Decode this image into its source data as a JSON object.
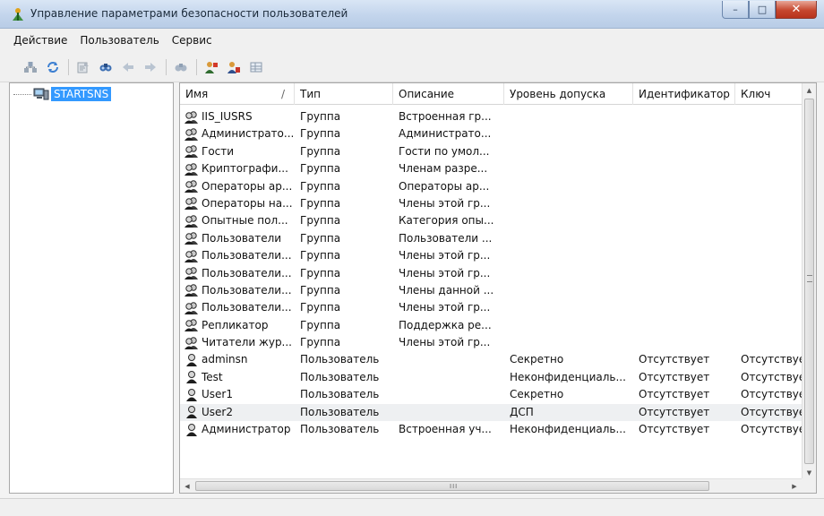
{
  "window": {
    "title": "Управление параметрами безопасности пользователей",
    "buttons": {
      "minimize": "–",
      "maximize": "□",
      "close": "✕"
    }
  },
  "menu": [
    {
      "label": "Действие"
    },
    {
      "label": "Пользователь"
    },
    {
      "label": "Сервис"
    }
  ],
  "toolbar": {
    "icons": [
      "network-connect-icon",
      "refresh-icon",
      "properties-icon",
      "find-icon",
      "back-arrow-icon",
      "forward-arrow-icon",
      "find-next-icon",
      "add-user-icon",
      "user-settings-icon",
      "grid-view-icon"
    ]
  },
  "tree": {
    "root_label": "STARTSNS"
  },
  "columns": [
    {
      "label": "Имя"
    },
    {
      "label": "Тип"
    },
    {
      "label": "Описание"
    },
    {
      "label": "Уровень допуска"
    },
    {
      "label": "Идентификатор"
    },
    {
      "label": "Ключ"
    }
  ],
  "sort_glyph": "/",
  "rows": [
    {
      "icon": "group",
      "name": "IIS_IUSRS",
      "type": "Группа",
      "description": "Встроенная гр...",
      "level": "",
      "id": "",
      "key": ""
    },
    {
      "icon": "group",
      "name": "Администрато...",
      "type": "Группа",
      "description": "Администрато...",
      "level": "",
      "id": "",
      "key": ""
    },
    {
      "icon": "group",
      "name": "Гости",
      "type": "Группа",
      "description": "Гости по умол...",
      "level": "",
      "id": "",
      "key": ""
    },
    {
      "icon": "group",
      "name": "Криптографи...",
      "type": "Группа",
      "description": "Членам разре...",
      "level": "",
      "id": "",
      "key": ""
    },
    {
      "icon": "group",
      "name": "Операторы ар...",
      "type": "Группа",
      "description": "Операторы ар...",
      "level": "",
      "id": "",
      "key": ""
    },
    {
      "icon": "group",
      "name": "Операторы на...",
      "type": "Группа",
      "description": "Члены этой гр...",
      "level": "",
      "id": "",
      "key": ""
    },
    {
      "icon": "group",
      "name": "Опытные пол...",
      "type": "Группа",
      "description": "Категория опы...",
      "level": "",
      "id": "",
      "key": ""
    },
    {
      "icon": "group",
      "name": "Пользователи",
      "type": "Группа",
      "description": "Пользователи ...",
      "level": "",
      "id": "",
      "key": ""
    },
    {
      "icon": "group",
      "name": "Пользователи...",
      "type": "Группа",
      "description": "Члены этой гр...",
      "level": "",
      "id": "",
      "key": ""
    },
    {
      "icon": "group",
      "name": "Пользователи...",
      "type": "Группа",
      "description": "Члены этой гр...",
      "level": "",
      "id": "",
      "key": ""
    },
    {
      "icon": "group",
      "name": "Пользователи...",
      "type": "Группа",
      "description": "Члены данной ...",
      "level": "",
      "id": "",
      "key": ""
    },
    {
      "icon": "group",
      "name": "Пользователи...",
      "type": "Группа",
      "description": "Члены этой гр...",
      "level": "",
      "id": "",
      "key": ""
    },
    {
      "icon": "group",
      "name": "Репликатор",
      "type": "Группа",
      "description": "Поддержка ре...",
      "level": "",
      "id": "",
      "key": ""
    },
    {
      "icon": "group",
      "name": "Читатели жур...",
      "type": "Группа",
      "description": "Члены этой гр...",
      "level": "",
      "id": "",
      "key": ""
    },
    {
      "icon": "user",
      "name": "adminsn",
      "type": "Пользователь",
      "description": "",
      "level": "Секретно",
      "id": "Отсутствует",
      "key": "Отсутствует"
    },
    {
      "icon": "user",
      "name": "Test",
      "type": "Пользователь",
      "description": "",
      "level": "Неконфиденциаль...",
      "id": "Отсутствует",
      "key": "Отсутствует"
    },
    {
      "icon": "user",
      "name": "User1",
      "type": "Пользователь",
      "description": "",
      "level": "Секретно",
      "id": "Отсутствует",
      "key": "Отсутствует"
    },
    {
      "icon": "user",
      "name": "User2",
      "type": "Пользователь",
      "description": "",
      "level": "ДСП",
      "id": "Отсутствует",
      "key": "Отсутствует",
      "selected": true
    },
    {
      "icon": "user",
      "name": "Администратор",
      "type": "Пользователь",
      "description": "Встроенная уч...",
      "level": "Неконфиденциаль...",
      "id": "Отсутствует",
      "key": "Отсутствует"
    }
  ],
  "scroll": {
    "h_grip": "III"
  },
  "status": {
    "text": ""
  }
}
